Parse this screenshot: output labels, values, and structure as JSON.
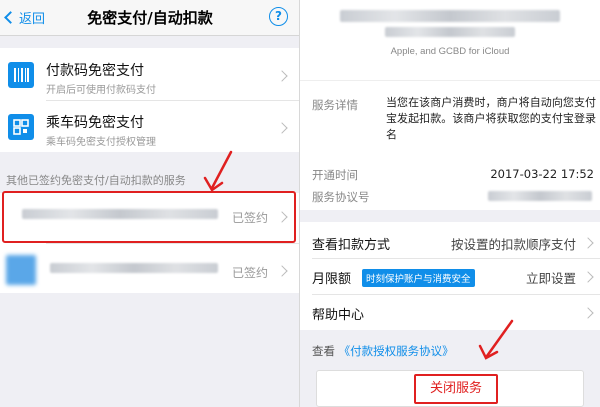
{
  "left": {
    "nav": {
      "back_label": "返回",
      "title": "免密支付/自动扣款",
      "help_glyph": "?"
    },
    "items": [
      {
        "title": "付款码免密支付",
        "subtitle": "开启后可使用付款码支付"
      },
      {
        "title": "乘车码免密支付",
        "subtitle": "乘车码免密支付授权管理"
      }
    ],
    "section_label": "其他已签约免密支付/自动扣款的服务",
    "services": [
      {
        "status": "已签约"
      },
      {
        "status": "已签约"
      }
    ]
  },
  "right": {
    "header_caption": "Apple, and GCBD for iCloud",
    "detail_label": "服务详情",
    "detail_text": "当您在该商户消费时，商户将自动向您支付宝发起扣款。该商户将获取您的支付宝登录名",
    "open_time_label": "开通时间",
    "open_time_value": "2017-03-22 17:52",
    "agreement_no_label": "服务协议号",
    "deduct_method_label": "查看扣款方式",
    "deduct_method_value": "按设置的扣款顺序支付",
    "monthly_limit_label": "月限额",
    "monthly_limit_tag": "时刻保护账户与消费安全",
    "monthly_limit_action": "立即设置",
    "help_center_label": "帮助中心",
    "view_label": "查看",
    "agreement_link": "《付款授权服务协议》",
    "close_button": "关闭服务"
  },
  "colors": {
    "accent": "#108ee9",
    "highlight": "#e02020"
  }
}
